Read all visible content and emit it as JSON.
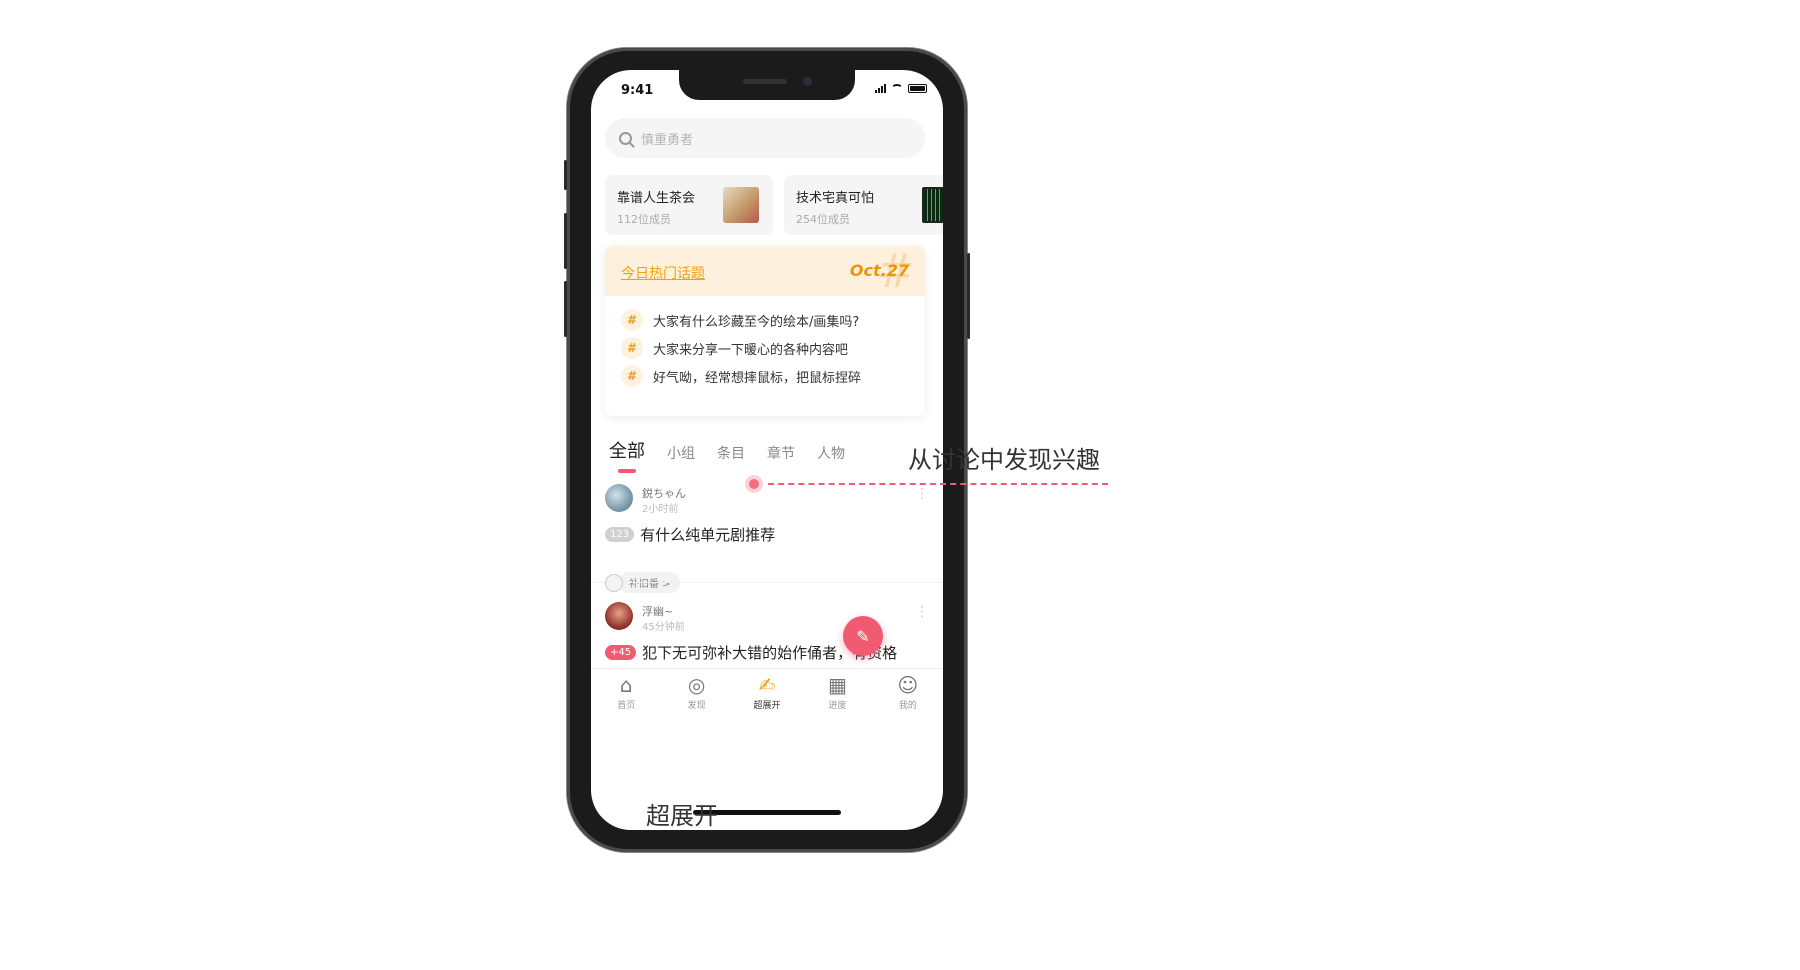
{
  "status": {
    "time": "9:41"
  },
  "search": {
    "placeholder": "慎重勇者"
  },
  "groups": [
    {
      "name": "靠谱人生茶会",
      "members": "112位成员"
    },
    {
      "name": "技术宅真可怕",
      "members": "254位成员"
    }
  ],
  "hot_topics": {
    "title": "今日热门话题",
    "date": "Oct.27",
    "items": [
      "大家有什么珍藏至今的绘本/画集吗?",
      "大家来分享一下暖心的各种内容吧",
      "好气呦，经常想摔鼠标，把鼠标捏碎"
    ]
  },
  "tabs": [
    "全部",
    "小组",
    "条目",
    "章节",
    "人物"
  ],
  "posts": [
    {
      "author": "鋭ちゃん",
      "time": "2小时前",
      "badge": "123",
      "title": "有什么纯单元剧推荐",
      "tag": "补旧番 >"
    },
    {
      "author": "浮幽~",
      "time": "45分钟前",
      "badge": "+45",
      "title": "犯下无可弥补大错的始作俑者，有资格"
    }
  ],
  "nav": [
    {
      "label": "首页",
      "icon": "home-icon"
    },
    {
      "label": "发现",
      "icon": "planet-icon"
    },
    {
      "label": "超展开",
      "icon": "chat-edit-icon"
    },
    {
      "label": "进度",
      "icon": "calendar-icon"
    },
    {
      "label": "我的",
      "icon": "cat-icon"
    }
  ],
  "annotation": {
    "text": "从讨论中发现兴趣"
  },
  "caption": "超展开",
  "colors": {
    "accent": "#f05b72",
    "hot": "#f0a20e",
    "hot_bg": "#fdf1dd"
  }
}
